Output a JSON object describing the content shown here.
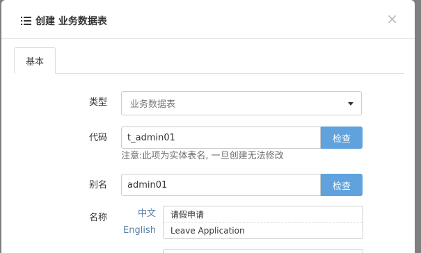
{
  "modal": {
    "title": "创建 业务数据表",
    "close_symbol": "×",
    "title_icon": "list-icon",
    "close_icon": "close-icon"
  },
  "tabs": [
    {
      "label": "基本",
      "active": true
    }
  ],
  "form": {
    "type": {
      "label": "类型",
      "value": "业务数据表",
      "icon": "caret-down-icon"
    },
    "code": {
      "label": "代码",
      "value": "t_admin01",
      "button": "检查",
      "hint": "注意:此项为实体表名, 一旦创建无法修改"
    },
    "alias": {
      "label": "别名",
      "value": "admin01",
      "button": "检查"
    },
    "name": {
      "label": "名称",
      "languages": [
        {
          "lang": "中文",
          "value": "请假申请"
        },
        {
          "lang": "English",
          "value": "Leave Application"
        }
      ]
    }
  },
  "colors": {
    "primary_button": "#5fa2dd",
    "backdrop": "#7f7f7f",
    "language_label": "#5a7fa6"
  }
}
